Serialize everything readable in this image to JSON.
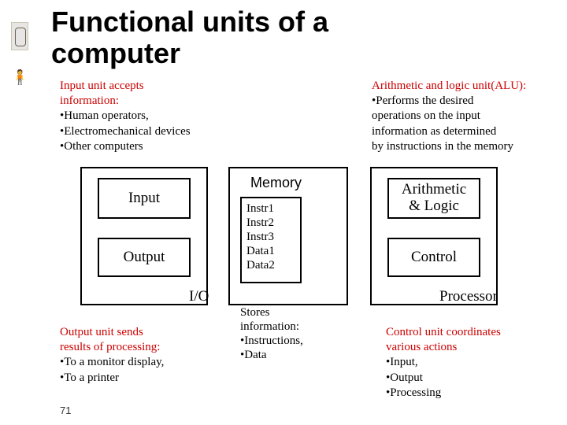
{
  "slide_number": "71",
  "title_line1": "Functional units of a",
  "title_line2": "computer",
  "input_desc": {
    "line1": "Input unit accepts",
    "line2": "information:",
    "b1": "•Human operators,",
    "b2": "•Electromechanical devices",
    "b3": "•Other computers"
  },
  "alu_desc": {
    "line1": "Arithmetic and logic unit(ALU):",
    "l2": "•Performs the desired",
    "l3": "operations on the input",
    "l4": "information as determined",
    "l5": "by instructions in the memory"
  },
  "boxes": {
    "input": "Input",
    "output": "Output",
    "io_label": "I/O",
    "memory_title": "Memory",
    "mem_items": {
      "i1": "Instr1",
      "i2": "Instr2",
      "i3": "Instr3",
      "i4": "Data1",
      "i5": "Data2"
    },
    "mem_below": {
      "l1": "Stores",
      "l2": "information:",
      "l3": "•Instructions,",
      "l4": "•Data"
    },
    "alu_l1": "Arithmetic",
    "alu_l2": "& Logic",
    "control": "Control",
    "processor_label": "Processor"
  },
  "output_desc": {
    "l1": "Output unit sends",
    "l2": "results of processing:",
    "l3": "•To a monitor display,",
    "l4": "•To a printer"
  },
  "control_desc": {
    "l1": "Control unit coordinates",
    "l2": "various actions",
    "l3": "•Input,",
    "l4": "•Output",
    "l5": "•Processing"
  }
}
